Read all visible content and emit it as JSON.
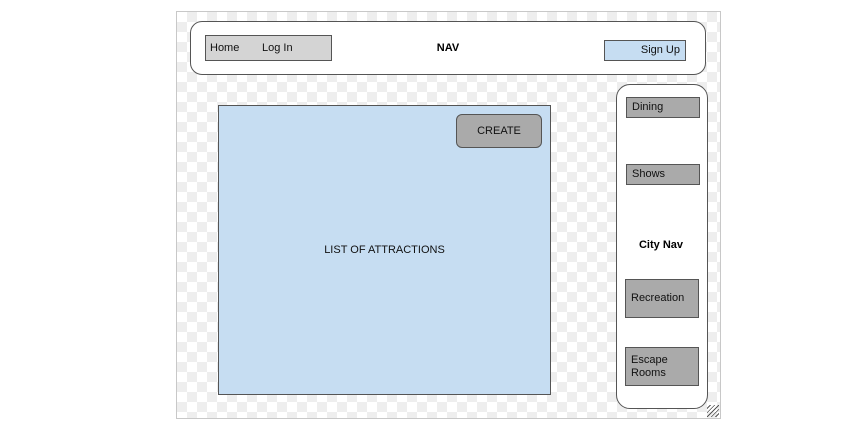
{
  "nav": {
    "links": [
      "Home",
      "Log In"
    ],
    "title": "NAV",
    "signup_label": "Sign Up"
  },
  "main": {
    "panel_label": "LIST OF ATTRACTIONS",
    "create_label": "CREATE"
  },
  "city_nav": {
    "title": "City Nav",
    "items": [
      "Dining",
      "Shows",
      "Recreation",
      "Escape Rooms"
    ]
  },
  "colors": {
    "accent": "#c6ddf2",
    "box_fill": "#aaaaaa",
    "link_box": "#d4d4d4"
  }
}
